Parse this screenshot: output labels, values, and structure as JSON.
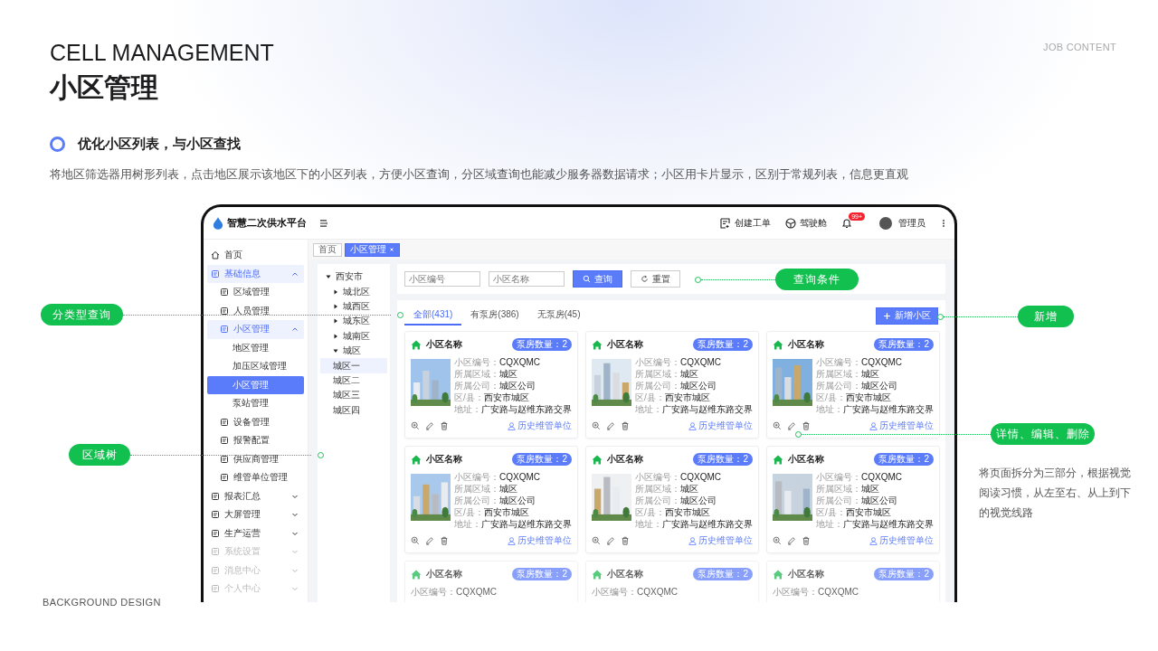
{
  "slide": {
    "subtitle_en": "CELL MANAGEMENT",
    "title": "小区管理",
    "corner_label": "JOB CONTENT",
    "section_heading": "优化小区列表，与小区查找",
    "description": "将地区筛选器用树形列表，点击地区展示该地区下的小区列表，方便小区查询，分区域查询也能减少服务器数据请求；小区用卡片显示，区别于常规列表，信息更直观",
    "side_note": "将页面拆分为三部分，根据视觉阅读习惯，从左至右、从上到下的视觉线路",
    "footer_label": "BACKGROUND DESIGN"
  },
  "app": {
    "brand": "智慧二次供水平台",
    "header_actions": [
      {
        "label": "创建工单"
      },
      {
        "label": "驾驶舱"
      }
    ],
    "notifications": {
      "badge": "99+"
    },
    "user": {
      "name": "管理员"
    },
    "sidebar": {
      "items": [
        {
          "label": "首页",
          "selected": false,
          "faded": false
        },
        {
          "label": "基础信息",
          "selected": false,
          "faded": false,
          "expanded": true,
          "children": [
            {
              "label": "区域管理",
              "selected": false
            },
            {
              "label": "人员管理",
              "selected": false
            },
            {
              "label": "小区管理",
              "selected": false,
              "expanded": true,
              "children": [
                {
                  "label": "地区管理",
                  "selected": false
                },
                {
                  "label": "加压区域管理",
                  "selected": false
                },
                {
                  "label": "小区管理",
                  "selected": true
                },
                {
                  "label": "泵站管理",
                  "selected": false
                }
              ]
            },
            {
              "label": "设备管理",
              "selected": false
            },
            {
              "label": "报警配置",
              "selected": false
            },
            {
              "label": "供应商管理",
              "selected": false
            },
            {
              "label": "维管单位管理",
              "selected": false
            }
          ]
        },
        {
          "label": "报表汇总",
          "selected": false,
          "faded": false,
          "expanded": false
        },
        {
          "label": "大屏管理",
          "selected": false,
          "faded": false,
          "expanded": false
        },
        {
          "label": "生产运营",
          "selected": false,
          "faded": false,
          "expanded": false
        },
        {
          "label": "系统设置",
          "selected": false,
          "faded": true,
          "expanded": false
        },
        {
          "label": "消息中心",
          "selected": false,
          "faded": true,
          "expanded": false
        },
        {
          "label": "个人中心",
          "selected": false,
          "faded": true,
          "expanded": false
        }
      ]
    },
    "page_tabs": [
      {
        "label": "首页",
        "selected": false,
        "closable": false
      },
      {
        "label": "小区管理",
        "selected": true,
        "closable": true
      }
    ],
    "region_tree": [
      {
        "label": "西安市",
        "selected": false,
        "expanded": true,
        "children": [
          {
            "label": "城北区",
            "selected": false,
            "expanded": false
          },
          {
            "label": "城西区",
            "selected": false,
            "expanded": false
          },
          {
            "label": "城东区",
            "selected": false,
            "expanded": false
          },
          {
            "label": "城南区",
            "selected": false,
            "expanded": false
          },
          {
            "label": "城区",
            "selected": false,
            "expanded": true,
            "children": [
              {
                "label": "城区一",
                "selected": true
              },
              {
                "label": "城区二",
                "selected": false
              },
              {
                "label": "城区三",
                "selected": false
              },
              {
                "label": "城区四",
                "selected": false
              }
            ]
          }
        ]
      }
    ],
    "search": {
      "fields": [
        {
          "placeholder": "小区编号"
        },
        {
          "placeholder": "小区名称"
        }
      ],
      "buttons": [
        {
          "label": "查询",
          "kind": "primary"
        },
        {
          "label": "重置",
          "kind": "reset"
        }
      ]
    },
    "list": {
      "tabs": [
        {
          "label": "全部(431)",
          "selected": true
        },
        {
          "label": "有泵房(386)",
          "selected": false
        },
        {
          "label": "无泵房(45)",
          "selected": false
        }
      ],
      "add_button": "新增小区",
      "cards": [
        {
          "name": "小区名称",
          "badge": "泵房数量：2",
          "faded": false,
          "fields": [
            {
              "label": "小区编号：",
              "value": "CQXQMC"
            },
            {
              "label": "所属区域：",
              "value": "城区"
            },
            {
              "label": "所属公司：",
              "value": "城区公司"
            },
            {
              "label": "区/县：",
              "value": "西安市城区"
            },
            {
              "label": "地址：",
              "value": "广安路与赵维东路交界"
            }
          ],
          "link": "历史维管单位"
        },
        {
          "name": "小区名称",
          "badge": "泵房数量：2",
          "faded": false,
          "fields": [
            {
              "label": "小区编号：",
              "value": "CQXQMC"
            },
            {
              "label": "所属区域：",
              "value": "城区"
            },
            {
              "label": "所属公司：",
              "value": "城区公司"
            },
            {
              "label": "区/县：",
              "value": "西安市城区"
            },
            {
              "label": "地址：",
              "value": "广安路与赵维东路交界"
            }
          ],
          "link": "历史维管单位"
        },
        {
          "name": "小区名称",
          "badge": "泵房数量：2",
          "faded": false,
          "fields": [
            {
              "label": "小区编号：",
              "value": "CQXQMC"
            },
            {
              "label": "所属区域：",
              "value": "城区"
            },
            {
              "label": "所属公司：",
              "value": "城区公司"
            },
            {
              "label": "区/县：",
              "value": "西安市城区"
            },
            {
              "label": "地址：",
              "value": "广安路与赵维东路交界"
            }
          ],
          "link": "历史维管单位"
        },
        {
          "name": "小区名称",
          "badge": "泵房数量：2",
          "faded": false,
          "fields": [
            {
              "label": "小区编号：",
              "value": "CQXQMC"
            },
            {
              "label": "所属区域：",
              "value": "城区"
            },
            {
              "label": "所属公司：",
              "value": "城区公司"
            },
            {
              "label": "区/县：",
              "value": "西安市城区"
            },
            {
              "label": "地址：",
              "value": "广安路与赵维东路交界"
            }
          ],
          "link": "历史维管单位"
        },
        {
          "name": "小区名称",
          "badge": "泵房数量：2",
          "faded": false,
          "fields": [
            {
              "label": "小区编号：",
              "value": "CQXQMC"
            },
            {
              "label": "所属区域：",
              "value": "城区"
            },
            {
              "label": "所属公司：",
              "value": "城区公司"
            },
            {
              "label": "区/县：",
              "value": "西安市城区"
            },
            {
              "label": "地址：",
              "value": "广安路与赵维东路交界"
            }
          ],
          "link": "历史维管单位"
        },
        {
          "name": "小区名称",
          "badge": "泵房数量：2",
          "faded": false,
          "fields": [
            {
              "label": "小区编号：",
              "value": "CQXQMC"
            },
            {
              "label": "所属区域：",
              "value": "城区"
            },
            {
              "label": "所属公司：",
              "value": "城区公司"
            },
            {
              "label": "区/县：",
              "value": "西安市城区"
            },
            {
              "label": "地址：",
              "value": "广安路与赵维东路交界"
            }
          ],
          "link": "历史维管单位"
        },
        {
          "name": "小区名称",
          "badge": "泵房数量：2",
          "faded": true,
          "fields": [
            {
              "label": "小区编号：",
              "value": "CQXQMC"
            }
          ]
        },
        {
          "name": "小区名称",
          "badge": "泵房数量：2",
          "faded": true,
          "fields": [
            {
              "label": "小区编号：",
              "value": "CQXQMC"
            }
          ]
        },
        {
          "name": "小区名称",
          "badge": "泵房数量：2",
          "faded": true,
          "fields": [
            {
              "label": "小区编号：",
              "value": "CQXQMC"
            }
          ]
        }
      ]
    }
  },
  "annotations": [
    {
      "label": "查询条件"
    },
    {
      "label": "分类型查询"
    },
    {
      "label": "新增"
    },
    {
      "label": "详情、编辑、删除"
    },
    {
      "label": "区域树"
    }
  ]
}
